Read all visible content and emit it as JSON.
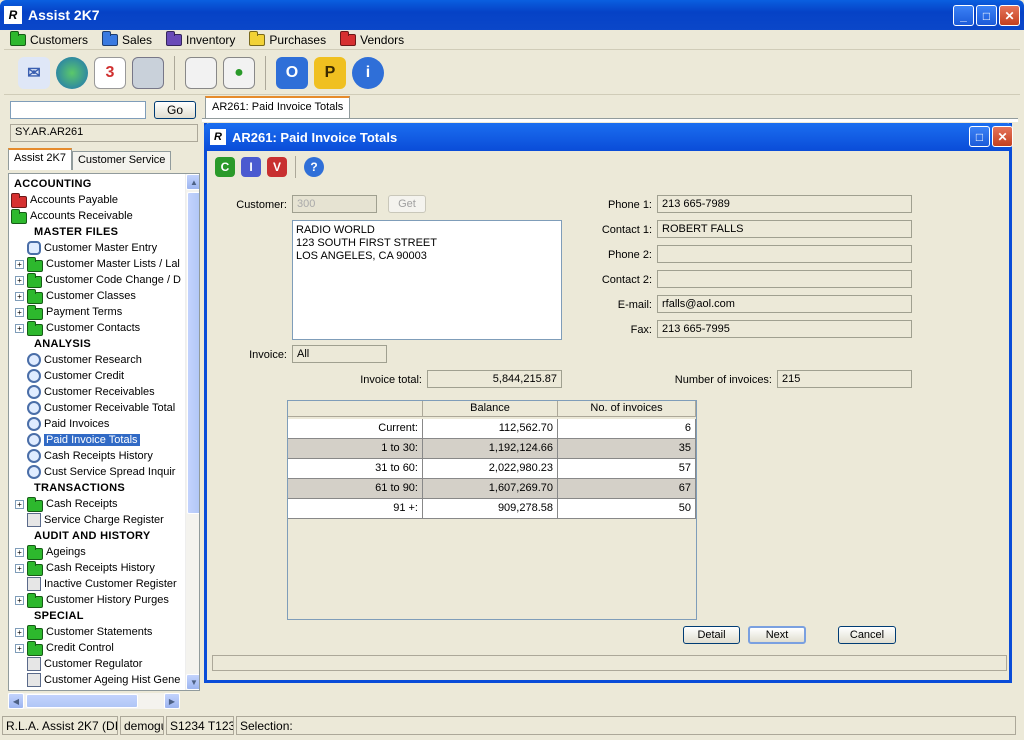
{
  "app": {
    "title": "Assist 2K7"
  },
  "menu": [
    {
      "label": "Customers",
      "color": "#2db82d"
    },
    {
      "label": "Sales",
      "color": "#3a7ae0"
    },
    {
      "label": "Inventory",
      "color": "#6a4bb8"
    },
    {
      "label": "Purchases",
      "color": "#f2d236"
    },
    {
      "label": "Vendors",
      "color": "#d63030"
    }
  ],
  "toolbar": {
    "icons": [
      "mail-icon",
      "globe-icon",
      "calendar-icon",
      "calculator-icon",
      "report-icon",
      "chart-report-icon",
      "outlook-icon",
      "p-icon",
      "info-icon"
    ],
    "calendar_text": "3"
  },
  "left": {
    "search_value": "",
    "go_label": "Go",
    "breadcrumb": "SY.AR.AR261",
    "tabs": [
      "Assist 2K7",
      "Customer Service"
    ],
    "tree": [
      {
        "label": "ACCOUNTING",
        "type": "header",
        "indent": 0
      },
      {
        "label": "Accounts Payable",
        "type": "folder",
        "color": "#d63030",
        "indent": 0
      },
      {
        "label": "Accounts Receivable",
        "type": "folder",
        "color": "#2db82d",
        "indent": 0
      },
      {
        "label": "MASTER FILES",
        "type": "header",
        "indent": 1
      },
      {
        "label": "Customer Master Entry",
        "type": "item",
        "icon": "entry",
        "indent": 1
      },
      {
        "label": "Customer Master Lists / Lal",
        "type": "folder",
        "color": "#2db82d",
        "indent": 1,
        "expander": "+"
      },
      {
        "label": "Customer Code Change / D",
        "type": "folder",
        "color": "#2db82d",
        "indent": 1,
        "expander": "+"
      },
      {
        "label": "Customer Classes",
        "type": "folder",
        "color": "#2db82d",
        "indent": 1,
        "expander": "+"
      },
      {
        "label": "Payment Terms",
        "type": "folder",
        "color": "#2db82d",
        "indent": 1,
        "expander": "+"
      },
      {
        "label": "Customer Contacts",
        "type": "folder",
        "color": "#2db82d",
        "indent": 1,
        "expander": "+"
      },
      {
        "label": "ANALYSIS",
        "type": "header",
        "indent": 1
      },
      {
        "label": "Customer Research",
        "type": "mag",
        "indent": 1
      },
      {
        "label": "Customer Credit",
        "type": "mag",
        "indent": 1
      },
      {
        "label": "Customer Receivables",
        "type": "mag",
        "indent": 1
      },
      {
        "label": "Customer Receivable Total",
        "type": "mag",
        "indent": 1
      },
      {
        "label": "Paid Invoices",
        "type": "mag",
        "indent": 1
      },
      {
        "label": "Paid Invoice Totals",
        "type": "mag",
        "indent": 1,
        "selected": true
      },
      {
        "label": "Cash Receipts History",
        "type": "mag",
        "indent": 1
      },
      {
        "label": "Cust Service Spread Inquir",
        "type": "mag",
        "indent": 1
      },
      {
        "label": "TRANSACTIONS",
        "type": "header",
        "indent": 1
      },
      {
        "label": "Cash Receipts",
        "type": "folder",
        "color": "#2db82d",
        "indent": 1,
        "expander": "+"
      },
      {
        "label": "Service Charge Register",
        "type": "doc",
        "indent": 1
      },
      {
        "label": "AUDIT AND HISTORY",
        "type": "header",
        "indent": 1
      },
      {
        "label": "Ageings",
        "type": "folder",
        "color": "#2db82d",
        "indent": 1,
        "expander": "+"
      },
      {
        "label": "Cash Receipts History",
        "type": "folder",
        "color": "#2db82d",
        "indent": 1,
        "expander": "+"
      },
      {
        "label": "Inactive Customer Register",
        "type": "doc",
        "indent": 1
      },
      {
        "label": "Customer History Purges",
        "type": "folder",
        "color": "#2db82d",
        "indent": 1,
        "expander": "+"
      },
      {
        "label": "SPECIAL",
        "type": "header",
        "indent": 1
      },
      {
        "label": "Customer Statements",
        "type": "folder",
        "color": "#2db82d",
        "indent": 1,
        "expander": "+"
      },
      {
        "label": "Credit Control",
        "type": "folder",
        "color": "#2db82d",
        "indent": 1,
        "expander": "+"
      },
      {
        "label": "Customer Regulator",
        "type": "doc",
        "indent": 1
      },
      {
        "label": "Customer Ageing Hist Gene",
        "type": "doc",
        "indent": 1
      }
    ]
  },
  "main": {
    "tab_label": "AR261: Paid Invoice Totals",
    "window_title": "AR261: Paid Invoice Totals",
    "inner_toolbar": [
      {
        "name": "c-icon",
        "letter": "C",
        "color": "#2a9a2a"
      },
      {
        "name": "i-icon",
        "letter": "I",
        "color": "#4a5ad0"
      },
      {
        "name": "v-icon",
        "letter": "V",
        "color": "#c83030"
      },
      {
        "name": "help-icon",
        "letter": "?",
        "color": "#2f6fd8"
      }
    ],
    "form": {
      "customer_label": "Customer:",
      "customer_value": "300",
      "get_label": "Get",
      "address_lines": [
        "RADIO WORLD",
        "123 SOUTH FIRST STREET",
        "LOS ANGELES, CA 90003"
      ],
      "invoice_label": "Invoice:",
      "invoice_value": "All",
      "invoice_total_label": "Invoice total:",
      "invoice_total_value": "5,844,215.87",
      "phone1_label": "Phone 1:",
      "phone1_value": "213 665-7989",
      "contact1_label": "Contact 1:",
      "contact1_value": "ROBERT FALLS",
      "phone2_label": "Phone 2:",
      "phone2_value": "",
      "contact2_label": "Contact 2:",
      "contact2_value": "",
      "email_label": "E-mail:",
      "email_value": "rfalls@aol.com",
      "fax_label": "Fax:",
      "fax_value": "213 665-7995",
      "num_invoices_label": "Number of invoices:",
      "num_invoices_value": "215"
    },
    "table": {
      "headers": [
        "",
        "Balance",
        "No. of invoices"
      ],
      "rows": [
        {
          "label": "Current:",
          "balance": "112,562.70",
          "count": "6"
        },
        {
          "label": "1 to 30:",
          "balance": "1,192,124.66",
          "count": "35"
        },
        {
          "label": "31 to 60:",
          "balance": "2,022,980.23",
          "count": "57"
        },
        {
          "label": "61 to 90:",
          "balance": "1,607,269.70",
          "count": "67"
        },
        {
          "label": "91 +:",
          "balance": "909,278.58",
          "count": "50"
        }
      ]
    },
    "buttons": {
      "detail": "Detail",
      "next": "Next",
      "cancel": "Cancel"
    }
  },
  "status": {
    "cells": [
      "R.L.A. Assist 2K7 (DIV)",
      "demogui",
      "S1234 T1234",
      "Selection:"
    ]
  }
}
